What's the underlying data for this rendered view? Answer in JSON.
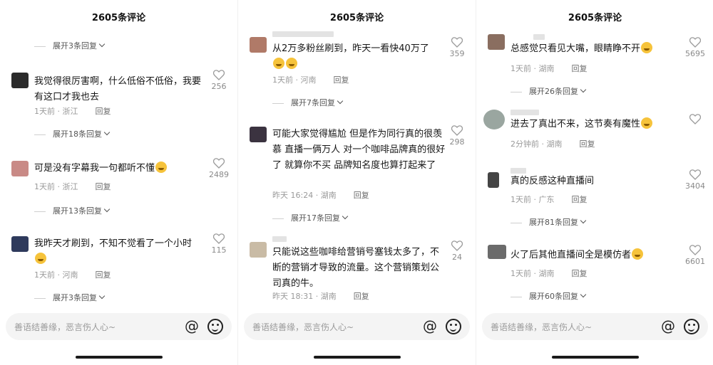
{
  "panels": [
    {
      "title": "2605条评论",
      "input_placeholder": "善语结善缘，恶言伤人心~",
      "at_symbol": "@",
      "top_expand": "展开3条回复",
      "comments": [
        {
          "text": "我觉得很厉害啊，什么低俗不低俗，我要有这口才我也去",
          "time": "1天前",
          "location": "浙江",
          "reply": "回复",
          "likes": "256",
          "expand": "展开18条回复"
        },
        {
          "text": "可是没有字幕我一句都听不懂",
          "time": "1天前",
          "location": "浙江",
          "reply": "回复",
          "likes": "2489",
          "expand": "展开13条回复"
        },
        {
          "text": "我昨天才刷到，不知不觉看了一个小时",
          "time": "1天前",
          "location": "河南",
          "reply": "回复",
          "likes": "115",
          "expand": "展开3条回复"
        }
      ]
    },
    {
      "title": "2605条评论",
      "input_placeholder": "善语结善缘，恶言伤人心~",
      "at_symbol": "@",
      "comments": [
        {
          "text": "从2万多粉丝刷到，昨天一看快40万了",
          "time": "1天前",
          "location": "河南",
          "reply": "回复",
          "likes": "359",
          "expand": "展开7条回复"
        },
        {
          "text": "可能大家觉得尴尬 但是作为同行真的很羡慕 直播一俩万人 对一个咖啡品牌真的很好了 就算你不买 品牌知名度也算打起来了",
          "time": "昨天 16:24",
          "location": "湖南",
          "reply": "回复",
          "likes": "298",
          "expand": "展开17条回复"
        },
        {
          "text": "只能说这些咖啡给营销号塞钱太多了，不断的营销才导致的流量。这个营销策划公司真的牛。",
          "time": "昨天 18:31",
          "location": "湖南",
          "reply": "回复",
          "likes": "24",
          "expand": ""
        }
      ]
    },
    {
      "title": "2605条评论",
      "input_placeholder": "善语结善缘，恶言伤人心~",
      "at_symbol": "@",
      "comments": [
        {
          "text": "总感觉只看见大嘴，眼睛睁不开",
          "time": "1天前",
          "location": "湖南",
          "reply": "回复",
          "likes": "5695",
          "expand": "展开26条回复"
        },
        {
          "text": "进去了真出不来，这节奏有魔性",
          "time": "2分钟前",
          "location": "湖南",
          "reply": "回复",
          "likes": "",
          "expand": ""
        },
        {
          "text": "真的反感这种直播间",
          "time": "1天前",
          "location": "广东",
          "reply": "回复",
          "likes": "3404",
          "expand": "展开81条回复"
        },
        {
          "text": "火了后其他直播间全是模仿者",
          "time": "1天前",
          "location": "湖南",
          "reply": "回复",
          "likes": "6601",
          "expand": "展开60条回复"
        }
      ]
    }
  ]
}
